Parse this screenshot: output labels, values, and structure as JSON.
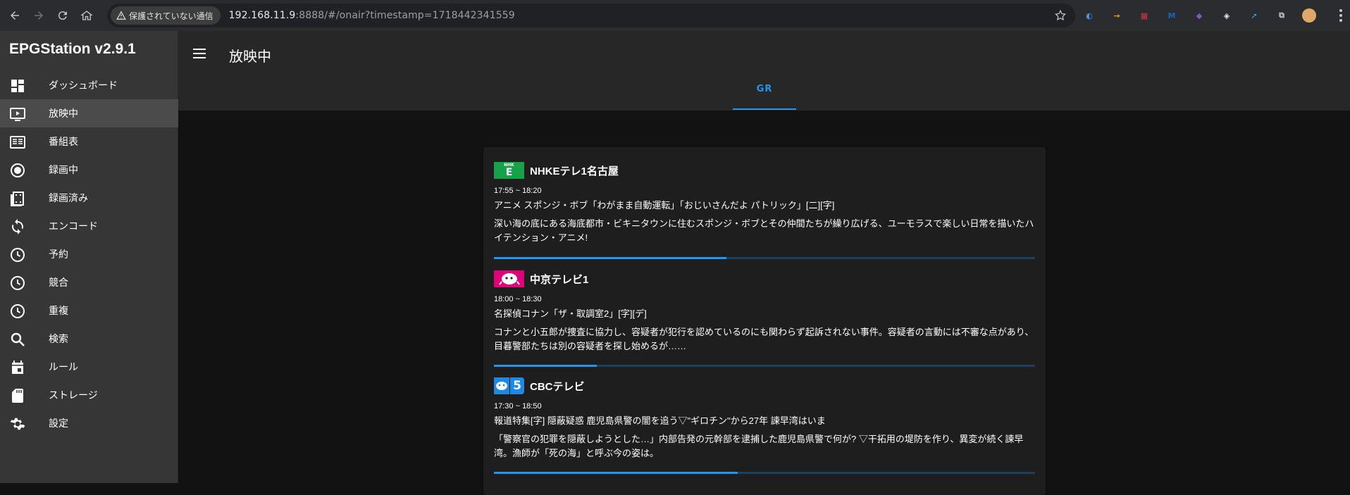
{
  "browser": {
    "security_label": "保護されていない通信",
    "url_host": "192.168.11.9",
    "url_path": ":8888/#/onair?timestamp=1718442341559",
    "extensions": [
      {
        "name": "ext-globe-icon",
        "color": "#4a90e2",
        "glyph": "◐"
      },
      {
        "name": "ext-amazon-icon",
        "color": "#ff9900",
        "glyph": "→"
      },
      {
        "name": "ext-red-icon",
        "color": "#d9353c",
        "glyph": "▦"
      },
      {
        "name": "ext-m-icon",
        "color": "#1565c0",
        "glyph": "M"
      },
      {
        "name": "ext-purple-icon",
        "color": "#7e57c2",
        "glyph": "◆",
        "badge": "10"
      },
      {
        "name": "ext-cube-icon",
        "color": "#e8eaed",
        "glyph": "◈"
      },
      {
        "name": "ext-arrow-icon",
        "color": "#29b6f6",
        "glyph": "➚"
      },
      {
        "name": "extensions-puzzle-icon",
        "color": "#c4c7c5",
        "glyph": "⧉"
      }
    ]
  },
  "app": {
    "title": "EPGStation v2.9.1",
    "page_title": "放映中",
    "tab_label": "GR"
  },
  "sidebar": {
    "items": [
      {
        "label": "ダッシュボード",
        "icon": "dashboard-icon"
      },
      {
        "label": "放映中",
        "icon": "tv-play-icon",
        "active": true
      },
      {
        "label": "番組表",
        "icon": "program-guide-icon"
      },
      {
        "label": "録画中",
        "icon": "record-icon"
      },
      {
        "label": "録画済み",
        "icon": "film-icon"
      },
      {
        "label": "エンコード",
        "icon": "sync-icon"
      },
      {
        "label": "予約",
        "icon": "clock-icon"
      },
      {
        "label": "競合",
        "icon": "clock-icon"
      },
      {
        "label": "重複",
        "icon": "clock-icon"
      },
      {
        "label": "検索",
        "icon": "search-icon"
      },
      {
        "label": "ルール",
        "icon": "calendar-icon"
      },
      {
        "label": "ストレージ",
        "icon": "sd-card-icon"
      },
      {
        "label": "設定",
        "icon": "gear-icon"
      }
    ]
  },
  "programs": [
    {
      "channel": "NHKEテレ1名古屋",
      "logo": {
        "bg": "#17a24a",
        "top": "NHK",
        "main": "E"
      },
      "time": "17:55 ~ 18:20",
      "title": "アニメ スポンジ・ボブ「わがまま自動運転」「おじいさんだよ パトリック」[二][字]",
      "desc": "深い海の底にある海底都市・ビキニタウンに住むスポンジ・ボブとその仲間たちが繰り広げる、ユーモラスで楽しい日常を描いたハイテンション・アニメ!",
      "progress": 0.43
    },
    {
      "channel": "中京テレビ1",
      "logo": {
        "bg": "#e0007a",
        "top": "",
        "main": ""
      },
      "time": "18:00 ~ 18:30",
      "title": "名探偵コナン「ザ・取調室2」[字][デ]",
      "desc": "コナンと小五郎が捜査に協力し、容疑者が犯行を認めているのにも関わらず起訴されない事件。容疑者の言動には不審な点があり、目暮警部たちは別の容疑者を探し始めるが……",
      "progress": 0.19
    },
    {
      "channel": "CBCテレビ",
      "logo": {
        "bg": "#1e88e5",
        "top": "",
        "main": "5"
      },
      "time": "17:30 ~ 18:50",
      "title": "報道特集[字] 隠蔽疑惑 鹿児島県警の闇を追う▽\"ギロチン\"から27年 諫早湾はいま",
      "desc": "「警察官の犯罪を隠蔽しようとした…」内部告発の元幹部を逮捕した鹿児島県警で何が? ▽干拓用の堤防を作り、異変が続く諫早湾。漁師が「死の海」と呼ぶ今の姿は。",
      "progress": 0.45
    }
  ]
}
